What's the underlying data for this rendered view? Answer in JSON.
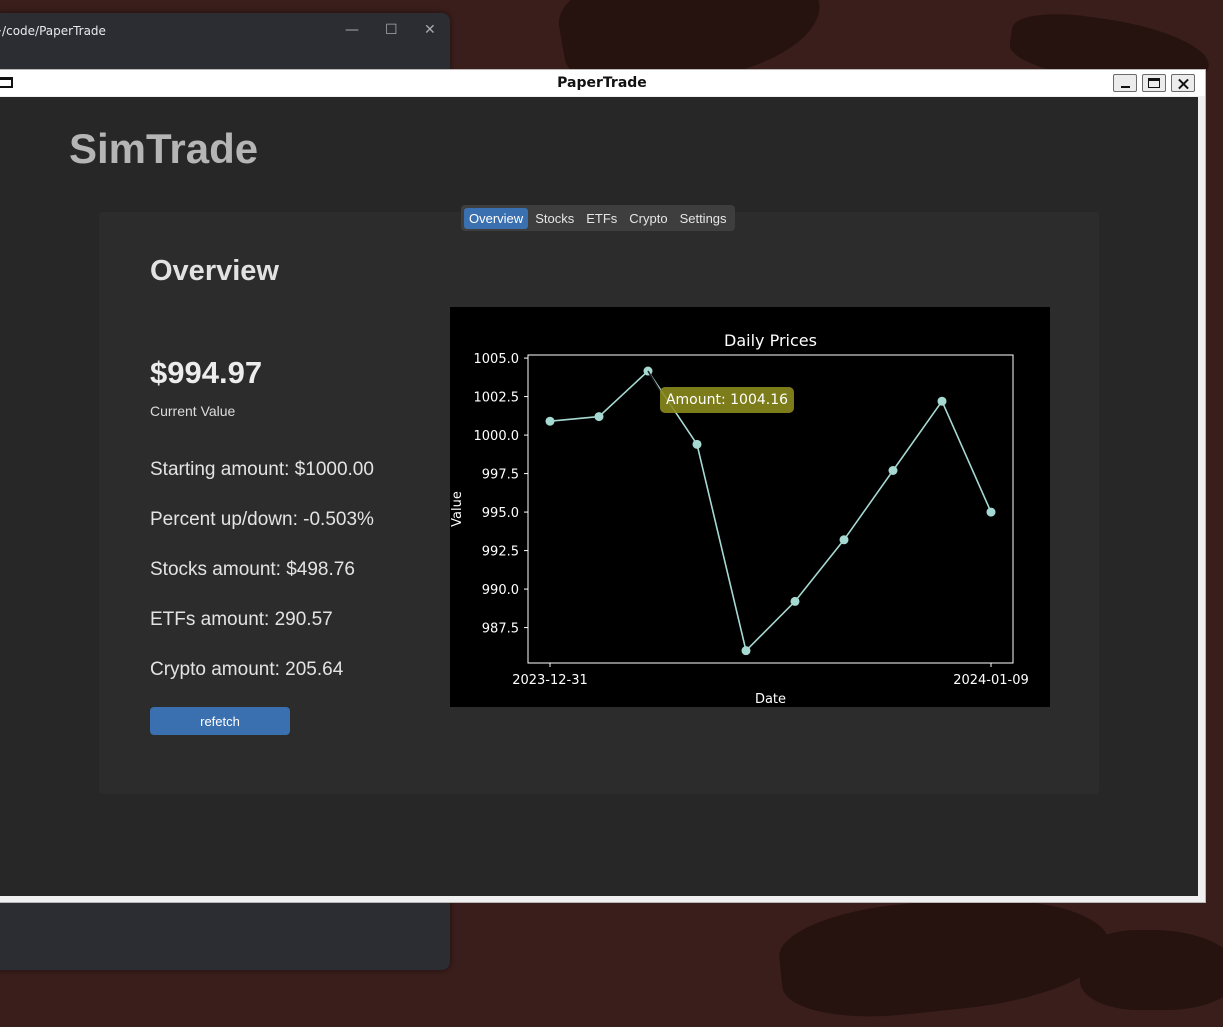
{
  "background_window": {
    "path": "~/code/PaperTrade",
    "min_glyph": "—",
    "max_glyph": "☐",
    "close_glyph": "✕"
  },
  "window": {
    "title": "PaperTrade"
  },
  "app": {
    "brand": "SimTrade",
    "tabs": [
      "Overview",
      "Stocks",
      "ETFs",
      "Crypto",
      "Settings"
    ],
    "active_tab": "Overview",
    "accent_color": "#3a6fb0"
  },
  "overview": {
    "heading": "Overview",
    "current_value": "$994.97",
    "current_value_label": "Current Value",
    "stats": [
      "Starting amount: $1000.00",
      "Percent up/down: -0.503%",
      "Stocks amount: $498.76",
      "ETFs amount: 290.57",
      "Crypto amount: 205.64"
    ],
    "refetch_label": "refetch"
  },
  "chart_data": {
    "type": "line",
    "title": "Daily Prices",
    "xlabel": "Date",
    "ylabel": "Value",
    "x": [
      "2023-12-31",
      "2024-01-01",
      "2024-01-02",
      "2024-01-03",
      "2024-01-04",
      "2024-01-05",
      "2024-01-06",
      "2024-01-07",
      "2024-01-08",
      "2024-01-09"
    ],
    "xticks": [
      "2023-12-31",
      "2024-01-09"
    ],
    "values": [
      1000.9,
      1001.2,
      1004.16,
      999.4,
      986.0,
      989.2,
      993.2,
      997.7,
      1002.2,
      995.0
    ],
    "ylim": [
      985.2,
      1005.2
    ],
    "yticks": [
      "987.5",
      "990.0",
      "992.5",
      "995.0",
      "997.5",
      "1000.0",
      "1002.5",
      "1005.0"
    ],
    "line_color": "#a6d9d1",
    "grid": false,
    "tooltip": {
      "text": "Amount: 1004.16",
      "point_index": 2,
      "color": "#8a8a1e"
    }
  }
}
